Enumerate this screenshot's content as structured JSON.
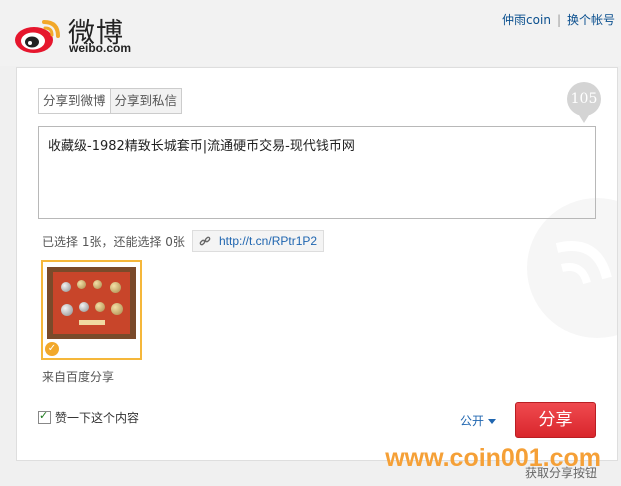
{
  "brand": {
    "name": "微博",
    "domain": "weibo.com"
  },
  "account": {
    "user": "仲雨coin",
    "switch_label": "换个帐号"
  },
  "tabs": [
    {
      "label": "分享到微博",
      "active": true
    },
    {
      "label": "分享到私信",
      "active": false
    }
  ],
  "char_counter": "105",
  "post": {
    "text": "收藏级-1982精致长城套币|流通硬币交易-现代钱币网"
  },
  "images": {
    "selected_text": "已选择 1张，还能选择 0张",
    "selected_count": 1,
    "remaining": 0,
    "source_label": "来自百度分享"
  },
  "shortlink": {
    "url": "http://t.cn/RPtr1P2",
    "icon": "link-icon"
  },
  "like": {
    "label": "赞一下这个内容",
    "checked": true
  },
  "privacy": {
    "label": "公开"
  },
  "share_button": {
    "label": "分享"
  },
  "footer": {
    "link_label": "获取分享按钮",
    "watermark": "www.coin001.com"
  },
  "colors": {
    "accent": "#e8343a",
    "link": "#2066b0",
    "selected_border": "#f5b73a"
  }
}
